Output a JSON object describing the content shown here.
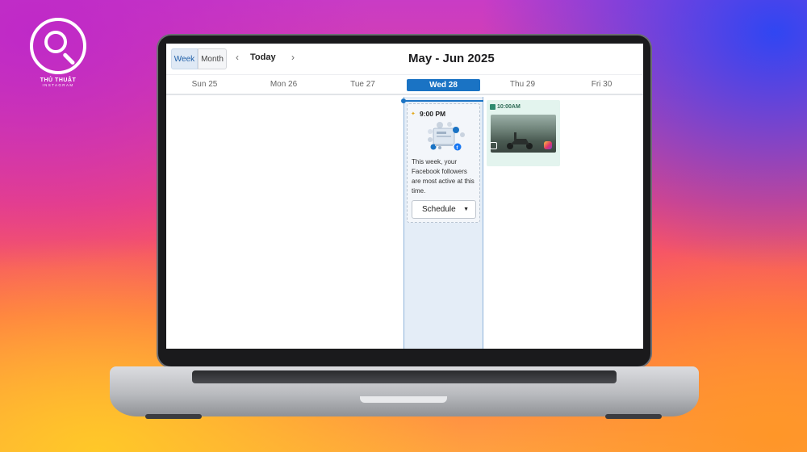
{
  "brand": {
    "title": "THỦ THUẬT",
    "subtitle": "INSTAGRAM"
  },
  "calendar": {
    "views": {
      "week": "Week",
      "month": "Month"
    },
    "nav": {
      "prev": "‹",
      "today": "Today",
      "next": "›"
    },
    "range_title": "May - Jun 2025",
    "days": [
      "Sun 25",
      "Mon 26",
      "Tue 27",
      "Wed 28",
      "Thu 29",
      "Fri 30"
    ],
    "active_day_index": 3
  },
  "insight": {
    "time": "9:00 PM",
    "text": "This week, your Facebook followers are most active at this time.",
    "button": "Schedule"
  },
  "scheduled_post": {
    "time": "10:00AM"
  },
  "colors": {
    "accent": "#1a73c4",
    "post_bg": "#e3f4ee",
    "active_column": "#e4edf7"
  }
}
